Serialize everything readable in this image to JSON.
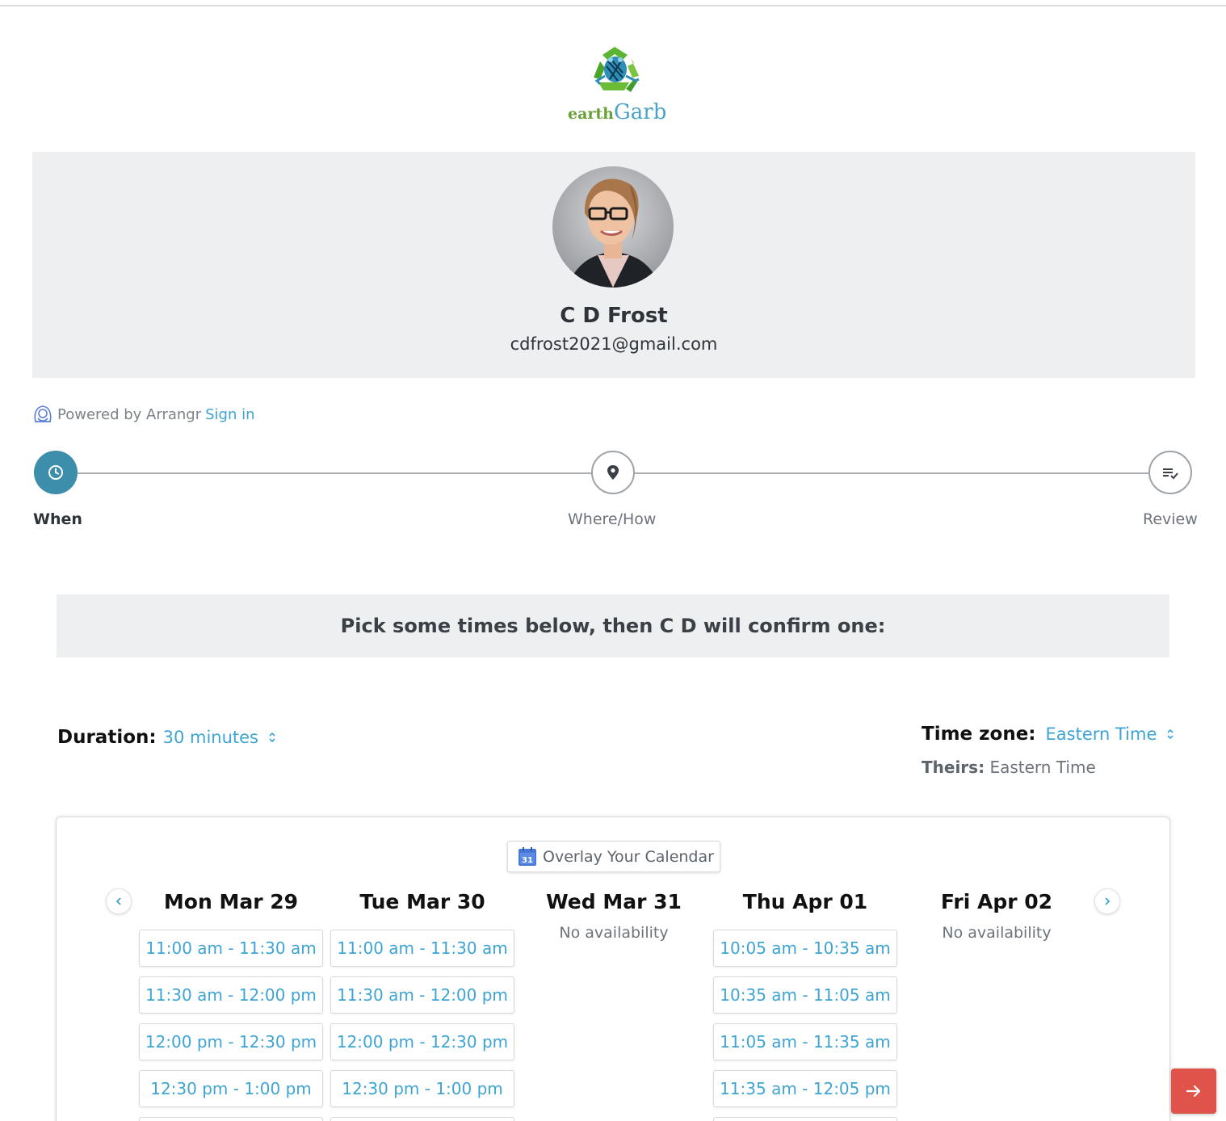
{
  "logo": {
    "earth": "earth",
    "garb": "Garb"
  },
  "profile": {
    "name": "C D Frost",
    "email": "cdfrost2021@gmail.com"
  },
  "powered": {
    "text": "Powered by Arrangr",
    "signin": "Sign in"
  },
  "steps": [
    {
      "label": "When",
      "icon": "clock-icon",
      "active": true
    },
    {
      "label": "Where/How",
      "icon": "location-pin-icon",
      "active": false
    },
    {
      "label": "Review",
      "icon": "review-list-icon",
      "active": false
    }
  ],
  "banner": "Pick some times below, then C D will confirm one:",
  "duration": {
    "label": "Duration:",
    "value": "30 minutes"
  },
  "timezone": {
    "label": "Time zone:",
    "value": "Eastern Time",
    "theirs_label": "Theirs:",
    "theirs_value": "Eastern Time"
  },
  "calendar": {
    "overlay_label": "Overlay Your Calendar",
    "overlay_icon_text": "31",
    "no_availability": "No availability",
    "days": [
      {
        "header": "Mon Mar 29",
        "slots": [
          "11:00 am - 11:30 am",
          "11:30 am - 12:00 pm",
          "12:00 pm - 12:30 pm",
          "12:30 pm - 1:00 pm",
          ""
        ]
      },
      {
        "header": "Tue Mar 30",
        "slots": [
          "11:00 am - 11:30 am",
          "11:30 am - 12:00 pm",
          "12:00 pm - 12:30 pm",
          "12:30 pm - 1:00 pm",
          ""
        ]
      },
      {
        "header": "Wed Mar 31",
        "slots": []
      },
      {
        "header": "Thu Apr 01",
        "slots": [
          "10:05 am - 10:35 am",
          "10:35 am - 11:05 am",
          "11:05 am - 11:35 am",
          "11:35 am - 12:05 pm",
          ""
        ]
      },
      {
        "header": "Fri Apr 02",
        "slots": []
      }
    ]
  },
  "colors": {
    "accent": "#3ea4d3",
    "step_active": "#3c8eaa",
    "next_button": "#e0534b",
    "panel": "#eeeff1"
  }
}
